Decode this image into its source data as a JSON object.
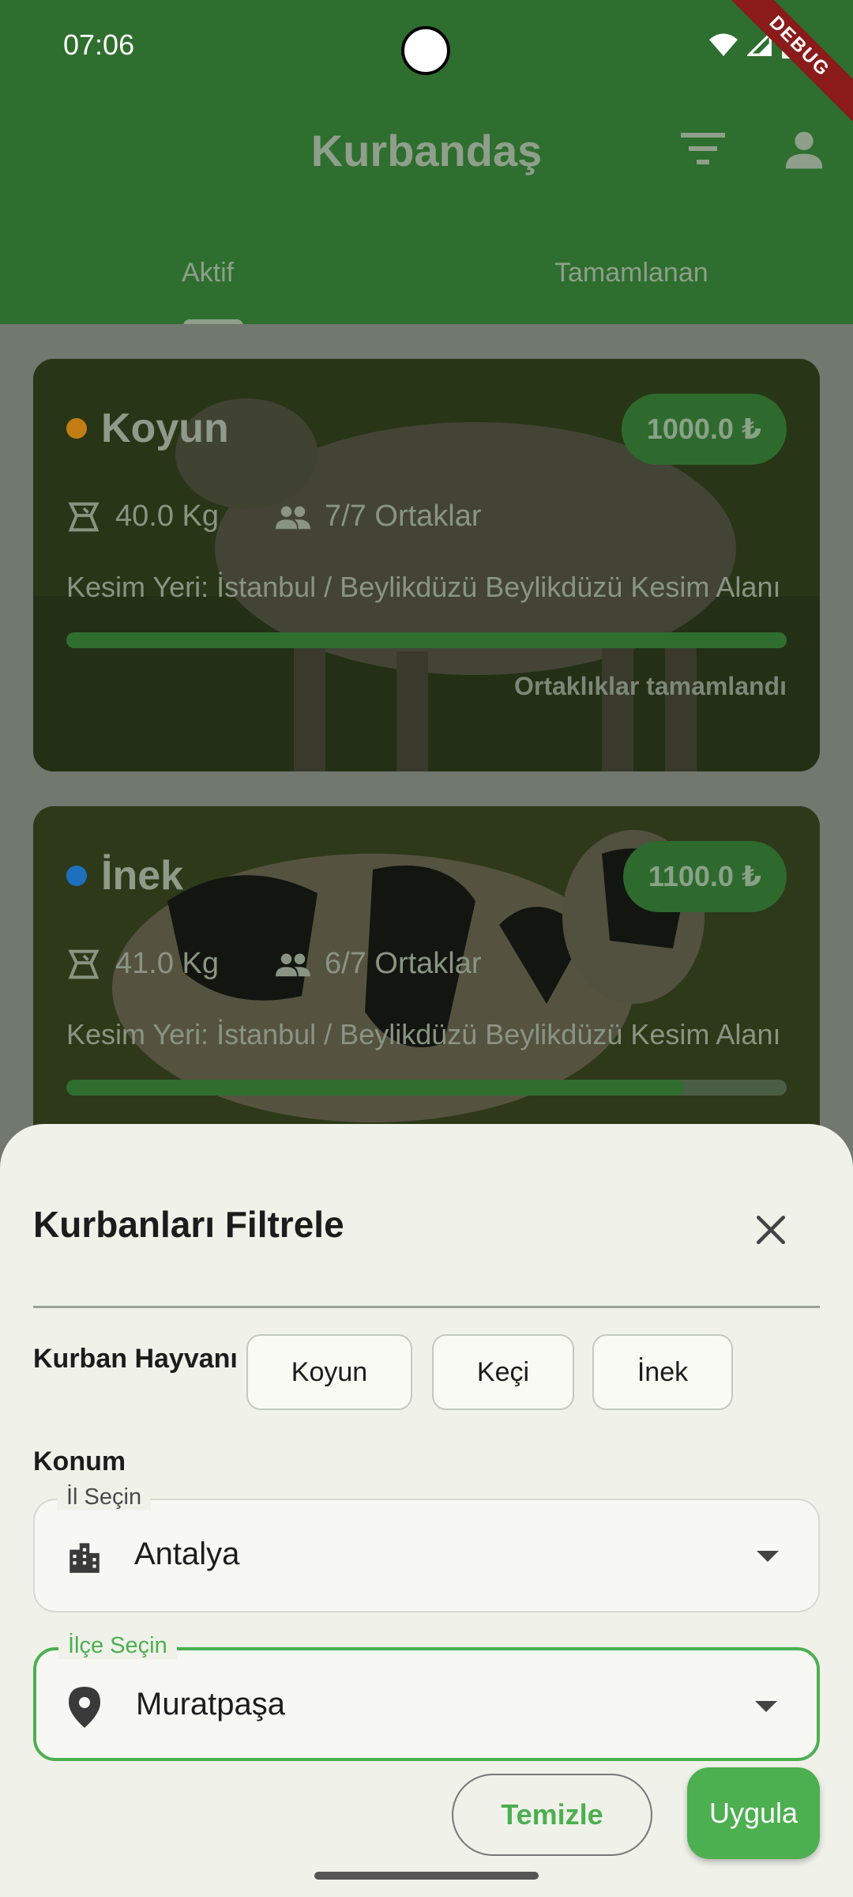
{
  "status_bar": {
    "time": "07:06",
    "debug_label": "DEBUG"
  },
  "app_bar": {
    "title": "Kurbandaş"
  },
  "tabs": [
    {
      "label": "Aktif",
      "selected": true
    },
    {
      "label": "Tamamlanan",
      "selected": false
    }
  ],
  "cards": [
    {
      "animal": "Koyun",
      "dot_color": "#c27d14",
      "price": "1000.0 ₺",
      "weight": "40.0 Kg",
      "partners": "7/7 Ortaklar",
      "location": "Kesim Yeri: İstanbul / Beylikdüzü Beylikdüzü Kesim Alanı",
      "progress": 1.0,
      "status": "Ortaklıklar tamamlandı"
    },
    {
      "animal": "İnek",
      "dot_color": "#1f6fbf",
      "price": "1100.0 ₺",
      "weight": "41.0 Kg",
      "partners": "6/7 Ortaklar",
      "location": "Kesim Yeri: İstanbul / Beylikdüzü Beylikdüzü Kesim Alanı",
      "progress": 0.857,
      "status": ""
    }
  ],
  "filter_sheet": {
    "title": "Kurbanları Filtrele",
    "animal_label": "Kurban Hayvanı",
    "animal_options": [
      "Koyun",
      "Keçi",
      "İnek"
    ],
    "location_label": "Konum",
    "province": {
      "label": "İl Seçin",
      "value": "Antalya"
    },
    "district": {
      "label": "İlçe Seçin",
      "value": "Muratpaşa"
    },
    "clear_button": "Temizle",
    "apply_button": "Uygula"
  },
  "colors": {
    "primary": "#2e6e2e",
    "accent": "#4caf50",
    "sheet_bg": "#f0f2ea"
  }
}
